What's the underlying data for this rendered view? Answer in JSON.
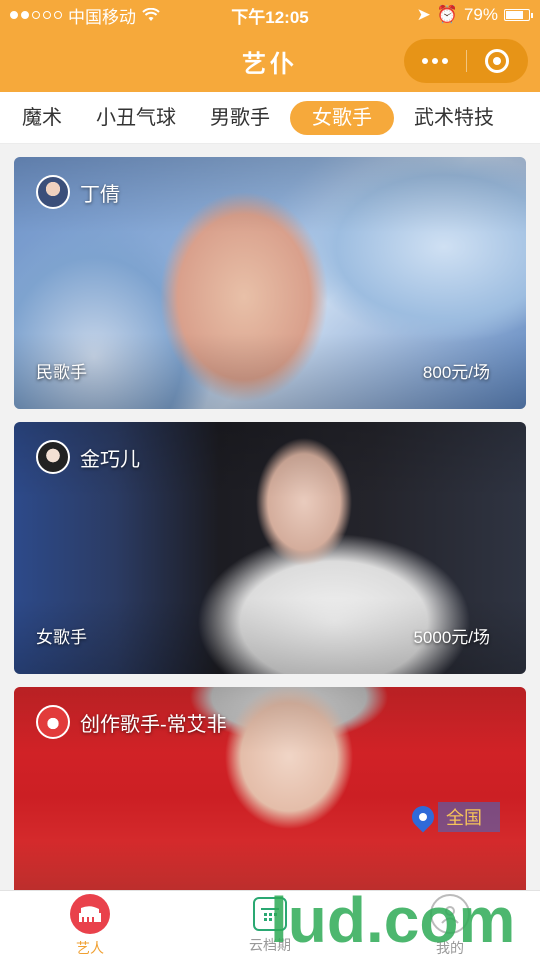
{
  "status_bar": {
    "carrier": "中国移动",
    "time": "下午12:05",
    "battery_percent": "79%",
    "battery_level": 0.79
  },
  "nav": {
    "title": "艺仆"
  },
  "tabs": [
    {
      "label": "魔术",
      "active": false
    },
    {
      "label": "小丑气球",
      "active": false
    },
    {
      "label": "男歌手",
      "active": false
    },
    {
      "label": "女歌手",
      "active": true
    },
    {
      "label": "武术特技",
      "active": false
    }
  ],
  "cards": [
    {
      "name": "丁倩",
      "tag": "民歌手",
      "price": "800元/场"
    },
    {
      "name": "金巧儿",
      "tag": "女歌手",
      "price": "5000元/场"
    },
    {
      "name": "创作歌手-常艾非",
      "location": "全国"
    }
  ],
  "tabbar": [
    {
      "label": "艺人",
      "active": true,
      "icon": "piano-icon"
    },
    {
      "label": "云档期",
      "active": false,
      "icon": "calendar-icon"
    },
    {
      "label": "我的",
      "active": false,
      "icon": "user-icon"
    }
  ],
  "watermark": {
    "text": "lud.com"
  },
  "colors": {
    "brand": "#f6a93b",
    "active_tab_icon_bg": "#e9414b",
    "pin": "#2f6ad8"
  }
}
